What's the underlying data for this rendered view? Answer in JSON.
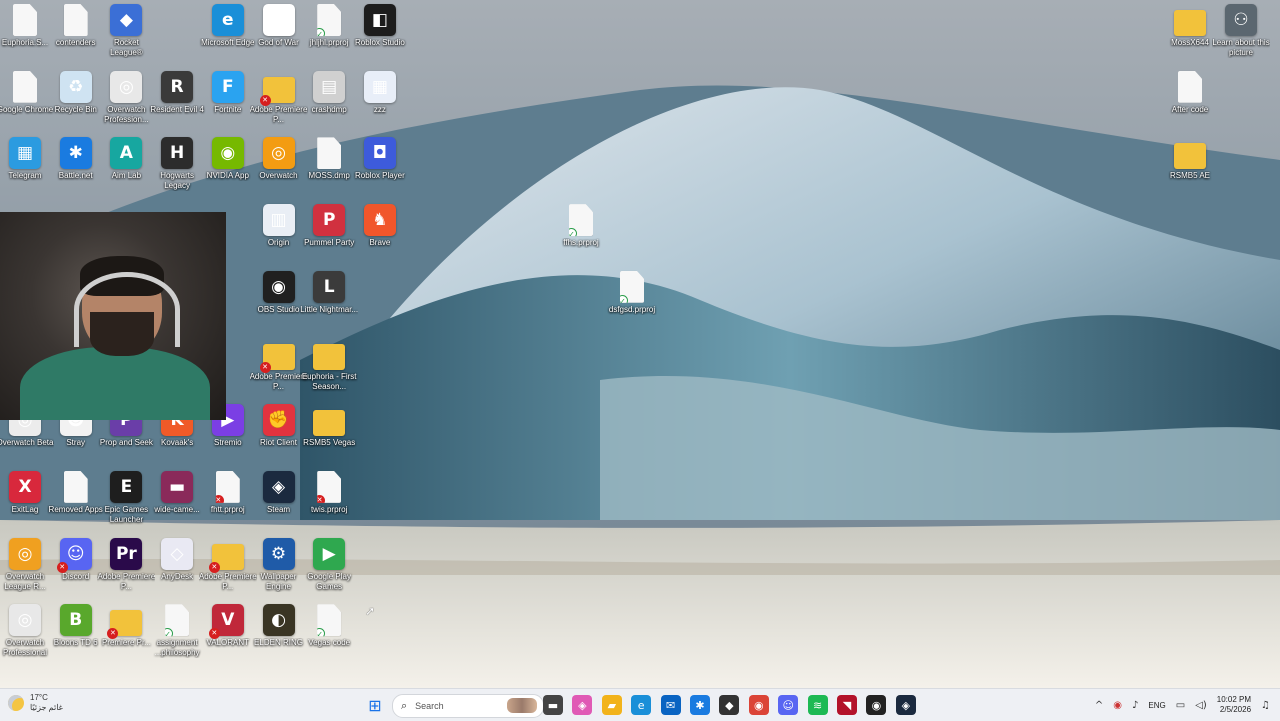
{
  "desktop": {
    "icons": [
      {
        "label": "Euphoria.S...",
        "kind": "doc",
        "color": "#f7f7f7",
        "glyph": "",
        "badge": ""
      },
      {
        "label": "contenders",
        "kind": "doc",
        "color": "#f7f7f7",
        "glyph": "",
        "badge": ""
      },
      {
        "label": "Rocket League®",
        "kind": "app",
        "color": "#3b6fd6",
        "glyph": "◆",
        "badge": ""
      },
      {
        "label": "Microsoft Edge",
        "kind": "app",
        "color": "#1a8fd8",
        "glyph": "e",
        "badge": ""
      },
      {
        "label": "God of War",
        "kind": "app",
        "color": "#ffffff",
        "glyph": "Ω",
        "badge": ""
      },
      {
        "label": "jhljhl.prproj",
        "kind": "doc",
        "color": "#f7f7f7",
        "glyph": "",
        "badge": "ok"
      },
      {
        "label": "Roblox Studio",
        "kind": "app",
        "color": "#1d1d1d",
        "glyph": "◧",
        "badge": ""
      },
      {
        "label": "Google Chrome",
        "kind": "doc",
        "color": "#f7f7f7",
        "glyph": "",
        "badge": ""
      },
      {
        "label": "Recycle Bin",
        "kind": "app",
        "color": "#cfe3f2",
        "glyph": "♻",
        "badge": ""
      },
      {
        "label": "Overwatch Profession...",
        "kind": "app",
        "color": "#e8e8e8",
        "glyph": "◎",
        "badge": ""
      },
      {
        "label": "Resident Evil 4",
        "kind": "app",
        "color": "#3a3a3a",
        "glyph": "R",
        "badge": ""
      },
      {
        "label": "Fortnite",
        "kind": "app",
        "color": "#2aa3f0",
        "glyph": "F",
        "badge": ""
      },
      {
        "label": "Adobe Premiere P...",
        "kind": "folder",
        "color": "#f2c23b",
        "glyph": "",
        "badge": "x"
      },
      {
        "label": "crashdmp",
        "kind": "app",
        "color": "#d0d0d0",
        "glyph": "▤",
        "badge": ""
      },
      {
        "label": "zzz",
        "kind": "app",
        "color": "#e8eef8",
        "glyph": "▦",
        "badge": ""
      },
      {
        "label": "Telegram",
        "kind": "app",
        "color": "#2b9be0",
        "glyph": "▦",
        "badge": ""
      },
      {
        "label": "Battle.net",
        "kind": "app",
        "color": "#1a7be0",
        "glyph": "✱",
        "badge": ""
      },
      {
        "label": "Aim Lab",
        "kind": "app",
        "color": "#17a7a0",
        "glyph": "A",
        "badge": ""
      },
      {
        "label": "Hogwarts Legacy",
        "kind": "app",
        "color": "#2c2c2c",
        "glyph": "H",
        "badge": ""
      },
      {
        "label": "NVIDIA App",
        "kind": "app",
        "color": "#76b900",
        "glyph": "◉",
        "badge": ""
      },
      {
        "label": "Overwatch",
        "kind": "app",
        "color": "#f39c12",
        "glyph": "◎",
        "badge": ""
      },
      {
        "label": "MOSS.dmp",
        "kind": "doc",
        "color": "#f7f7f7",
        "glyph": "",
        "badge": ""
      },
      {
        "label": "Roblox Player",
        "kind": "app",
        "color": "#3d5bdb",
        "glyph": "◘",
        "badge": ""
      },
      {
        "label": "Origin",
        "kind": "app",
        "color": "#e9eef5",
        "glyph": "▥",
        "badge": ""
      },
      {
        "label": "Pummel Party",
        "kind": "app",
        "color": "#d1313f",
        "glyph": "P",
        "badge": ""
      },
      {
        "label": "Brave",
        "kind": "app",
        "color": "#f1562b",
        "glyph": "♞",
        "badge": ""
      },
      {
        "label": "OBS Studio",
        "kind": "app",
        "color": "#202020",
        "glyph": "◉",
        "badge": ""
      },
      {
        "label": "Little Nightmar...",
        "kind": "app",
        "color": "#3b3b3b",
        "glyph": "L",
        "badge": ""
      },
      {
        "label": "Adobe Premiere P...",
        "kind": "folder",
        "color": "#f2c23b",
        "glyph": "",
        "badge": "x"
      },
      {
        "label": "Euphoria - First Season...",
        "kind": "folder",
        "color": "#f2c23b",
        "glyph": "",
        "badge": ""
      },
      {
        "label": "Overwatch Beta",
        "kind": "app",
        "color": "#ececec",
        "glyph": "◎",
        "badge": ""
      },
      {
        "label": "Stray",
        "kind": "app",
        "color": "#f2f2f2",
        "glyph": "☻",
        "badge": ""
      },
      {
        "label": "Prop and Seek",
        "kind": "app",
        "color": "#6a3ea8",
        "glyph": "P",
        "badge": ""
      },
      {
        "label": "Kovaak's",
        "kind": "app",
        "color": "#f05a28",
        "glyph": "K",
        "badge": ""
      },
      {
        "label": "Stremio",
        "kind": "app",
        "color": "#7b3fe4",
        "glyph": "▶",
        "badge": ""
      },
      {
        "label": "Riot Client",
        "kind": "app",
        "color": "#e2333f",
        "glyph": "✊",
        "badge": ""
      },
      {
        "label": "RSMB5 Vegas",
        "kind": "folder",
        "color": "#f2c23b",
        "glyph": "",
        "badge": ""
      },
      {
        "label": "ExitLag",
        "kind": "app",
        "color": "#d8283c",
        "glyph": "X",
        "badge": ""
      },
      {
        "label": "Removed Apps",
        "kind": "doc",
        "color": "#f7f7f7",
        "glyph": "",
        "badge": ""
      },
      {
        "label": "Epic Games Launcher",
        "kind": "app",
        "color": "#1e1e1e",
        "glyph": "E",
        "badge": ""
      },
      {
        "label": "wide-came...",
        "kind": "app",
        "color": "#8a2a5a",
        "glyph": "▬",
        "badge": ""
      },
      {
        "label": "fhtt.prproj",
        "kind": "doc",
        "color": "#f7f7f7",
        "glyph": "",
        "badge": "x"
      },
      {
        "label": "Steam",
        "kind": "app",
        "color": "#1b2a3f",
        "glyph": "◈",
        "badge": ""
      },
      {
        "label": "twis.prproj",
        "kind": "doc",
        "color": "#f7f7f7",
        "glyph": "",
        "badge": "x"
      },
      {
        "label": "Overwatch League R...",
        "kind": "app",
        "color": "#f0a020",
        "glyph": "◎",
        "badge": ""
      },
      {
        "label": "Discord",
        "kind": "app",
        "color": "#5865f2",
        "glyph": "☺",
        "badge": "x"
      },
      {
        "label": "Adobe Premiere P...",
        "kind": "app",
        "color": "#2a0a4a",
        "glyph": "Pr",
        "badge": ""
      },
      {
        "label": "AnyDesk",
        "kind": "app",
        "color": "#e9e9f3",
        "glyph": "◇",
        "badge": ""
      },
      {
        "label": "Adobe Premiere P...",
        "kind": "folder",
        "color": "#f2c23b",
        "glyph": "",
        "badge": "x"
      },
      {
        "label": "Wallpaper Engine",
        "kind": "app",
        "color": "#1f5ba8",
        "glyph": "⚙",
        "badge": ""
      },
      {
        "label": "Google Play Games",
        "kind": "app",
        "color": "#2fa84f",
        "glyph": "▶",
        "badge": ""
      },
      {
        "label": "Overwatch Professional",
        "kind": "app",
        "color": "#e8e8e8",
        "glyph": "◎",
        "badge": ""
      },
      {
        "label": "Bloons TD 6",
        "kind": "app",
        "color": "#59a82c",
        "glyph": "B",
        "badge": ""
      },
      {
        "label": "Premiere Pr...",
        "kind": "folder",
        "color": "#f2c23b",
        "glyph": "",
        "badge": "x"
      },
      {
        "label": "assignment ...philosophy",
        "kind": "doc",
        "color": "#f7f7f7",
        "glyph": "",
        "badge": "ok"
      },
      {
        "label": "VALORANT",
        "kind": "app",
        "color": "#c0283a",
        "glyph": "V",
        "badge": "x"
      },
      {
        "label": "ELDEN RING",
        "kind": "app",
        "color": "#3a3524",
        "glyph": "◐",
        "badge": ""
      },
      {
        "label": "Vegas code",
        "kind": "doc",
        "color": "#f7f7f7",
        "glyph": "",
        "badge": "ok"
      },
      {
        "label": "ffhs.prproj",
        "kind": "doc",
        "color": "#f7f7f7",
        "glyph": "",
        "badge": "ok"
      },
      {
        "label": "dsfgsd.prproj",
        "kind": "doc",
        "color": "#f7f7f7",
        "glyph": "",
        "badge": "ok"
      },
      {
        "label": "MossX644",
        "kind": "folder",
        "color": "#f2c23b",
        "glyph": "",
        "badge": ""
      },
      {
        "label": "Learn about this picture",
        "kind": "app",
        "color": "#5b6770",
        "glyph": "⚇",
        "badge": ""
      },
      {
        "label": "After code",
        "kind": "doc",
        "color": "#f7f7f7",
        "glyph": "",
        "badge": ""
      },
      {
        "label": "RSMB5 AE",
        "kind": "folder",
        "color": "#f2c23b",
        "glyph": "",
        "badge": ""
      }
    ]
  },
  "taskbar": {
    "weather": {
      "temp": "17°C",
      "desc": "غائم جزئيًا"
    },
    "search_placeholder": "Search",
    "pinned": [
      {
        "name": "file-icon",
        "glyph": "▬",
        "color": "#444"
      },
      {
        "name": "copilot-icon",
        "glyph": "◈",
        "color": "#e05ab5"
      },
      {
        "name": "file-explorer-icon",
        "glyph": "▰",
        "color": "#f2b31b"
      },
      {
        "name": "edge-icon",
        "glyph": "e",
        "color": "#1a8fd8"
      },
      {
        "name": "outlook-icon",
        "glyph": "✉",
        "color": "#0a64c2"
      },
      {
        "name": "battlenet-icon",
        "glyph": "✱",
        "color": "#1a7be0"
      },
      {
        "name": "epic-icon",
        "glyph": "◆",
        "color": "#333"
      },
      {
        "name": "chrome-icon",
        "glyph": "◉",
        "color": "#db4437"
      },
      {
        "name": "discord-icon",
        "glyph": "☺",
        "color": "#5865f2"
      },
      {
        "name": "spotify-icon",
        "glyph": "≋",
        "color": "#1db954"
      },
      {
        "name": "game-icon",
        "glyph": "◥",
        "color": "#b3122a"
      },
      {
        "name": "obs-icon",
        "glyph": "◉",
        "color": "#222"
      },
      {
        "name": "steam-icon",
        "glyph": "◈",
        "color": "#1b2a3f"
      }
    ],
    "tray": {
      "chevron": "^",
      "lang": "ENG",
      "time": "10:02 PM",
      "date": "2/5/2026"
    }
  }
}
